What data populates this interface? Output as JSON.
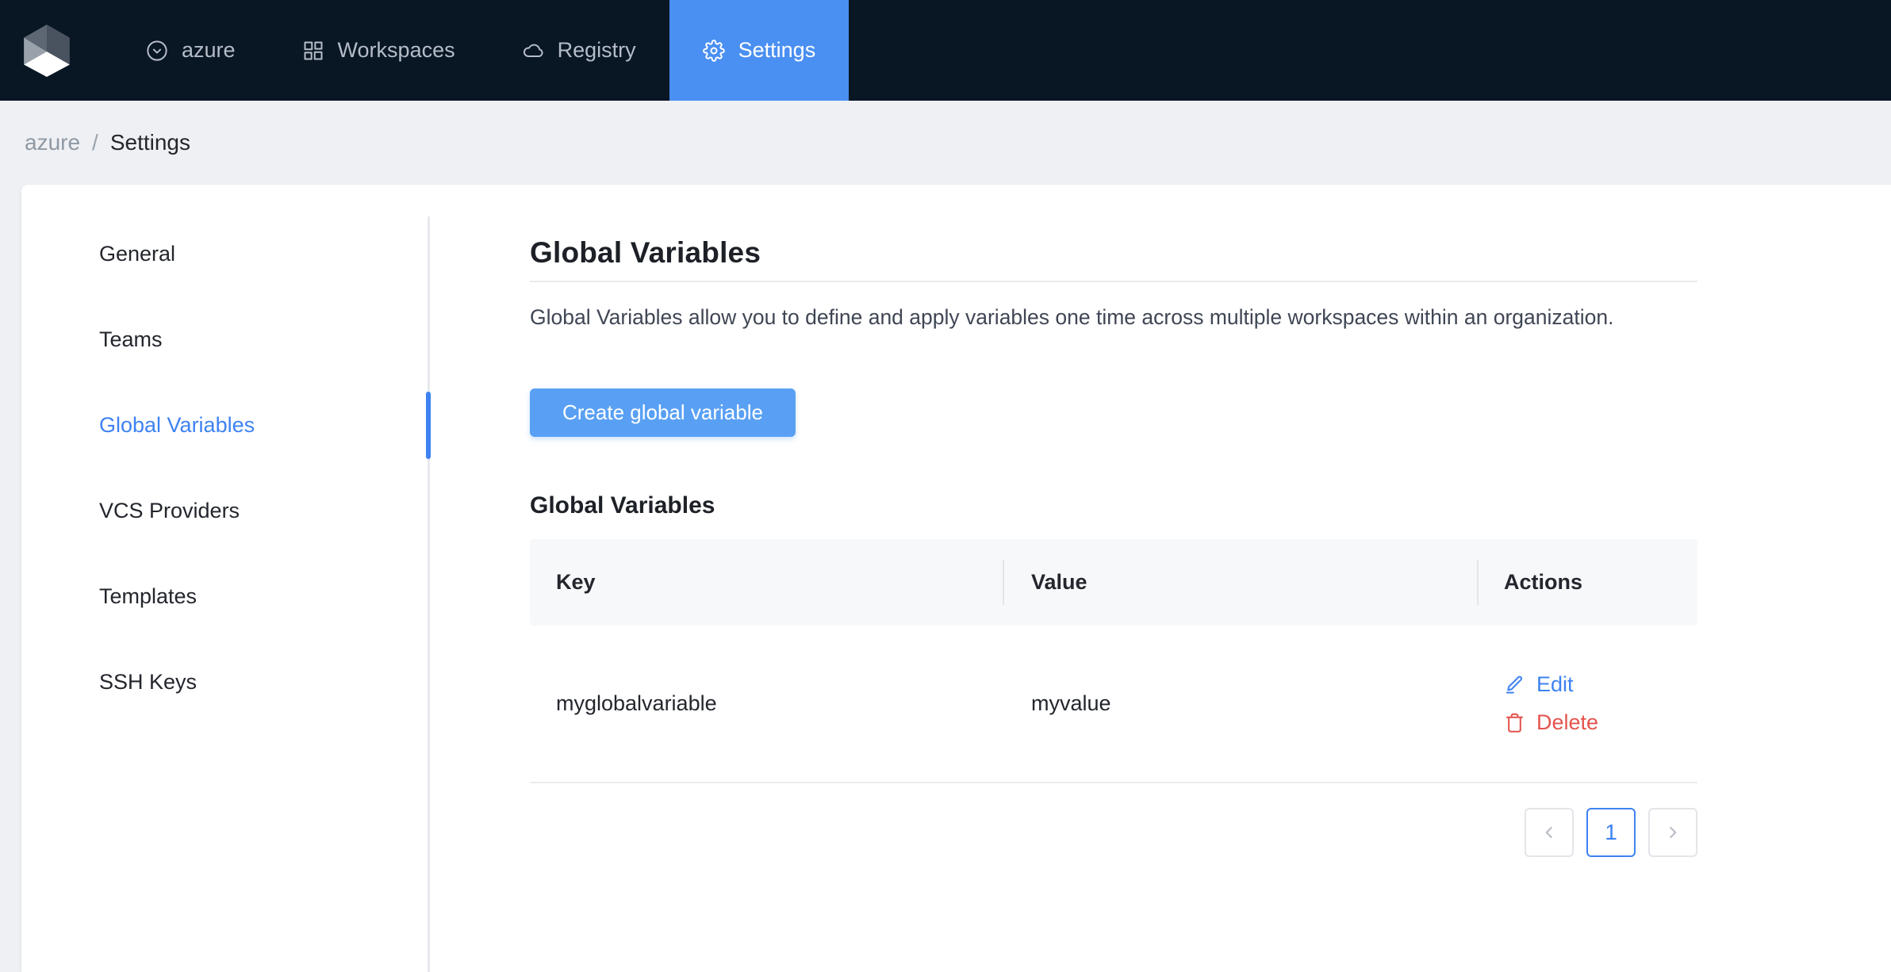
{
  "nav": {
    "logo_icon": "cube-logo",
    "items": [
      {
        "label": "azure",
        "icon": "chevron-circle-icon",
        "active": false
      },
      {
        "label": "Workspaces",
        "icon": "grid-icon",
        "active": false
      },
      {
        "label": "Registry",
        "icon": "cloud-icon",
        "active": false
      },
      {
        "label": "Settings",
        "icon": "gear-icon",
        "active": true
      }
    ],
    "avatar_icon": "user-icon"
  },
  "breadcrumb": {
    "org": "azure",
    "separator": "/",
    "page": "Settings"
  },
  "sidebar": {
    "items": [
      {
        "label": "General",
        "active": false
      },
      {
        "label": "Teams",
        "active": false
      },
      {
        "label": "Global Variables",
        "active": true
      },
      {
        "label": "VCS Providers",
        "active": false
      },
      {
        "label": "Templates",
        "active": false
      },
      {
        "label": "SSH Keys",
        "active": false
      }
    ]
  },
  "main": {
    "title": "Global Variables",
    "description": "Global Variables allow you to define and apply variables one time across multiple workspaces within an organization.",
    "create_button_label": "Create global variable",
    "table": {
      "heading": "Global Variables",
      "columns": [
        "Key",
        "Value",
        "Actions"
      ],
      "rows": [
        {
          "key": "myglobalvariable",
          "value": "myvalue",
          "actions": [
            {
              "label": "Edit",
              "icon": "pencil-icon",
              "color": "#3e82f2"
            },
            {
              "label": "Delete",
              "icon": "trash-icon",
              "color": "#e4534e"
            }
          ]
        }
      ]
    },
    "pagination": {
      "prev_icon": "chevron-left-icon",
      "next_icon": "chevron-right-icon",
      "pages": [
        "1"
      ],
      "active_page": "1"
    }
  },
  "colors": {
    "navbar_bg": "#091624",
    "active_tab_blue": "#4a8ff2",
    "button_blue": "#59a0f4",
    "link_blue": "#3e82f2",
    "danger_red": "#e4534e",
    "page_bg": "#eef0f4",
    "card_bg": "#ffffff"
  }
}
